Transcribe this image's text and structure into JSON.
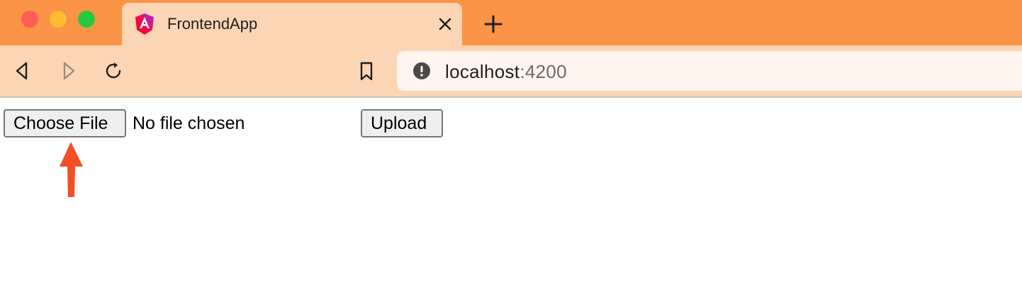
{
  "browser": {
    "tab": {
      "title": "FrontendApp",
      "favicon": "angular-logo-icon",
      "close_icon": "close-icon"
    },
    "new_tab_icon": "plus-icon",
    "toolbar": {
      "back_icon": "back-arrow-icon",
      "forward_icon": "forward-arrow-icon",
      "reload_icon": "reload-icon",
      "bookmark_icon": "bookmark-icon"
    },
    "address_bar": {
      "info_icon": "info-icon",
      "host": "localhost",
      "port": ":4200"
    },
    "colors": {
      "titlebar": "#fb9446",
      "tab_and_toolbar": "#fcd5b5",
      "address_bar": "#fef5ef"
    }
  },
  "page": {
    "file_input": {
      "button_label": "Choose File",
      "status_text": "No file chosen"
    },
    "upload_button_label": "Upload",
    "annotation_arrow_color": "#f44e26"
  }
}
